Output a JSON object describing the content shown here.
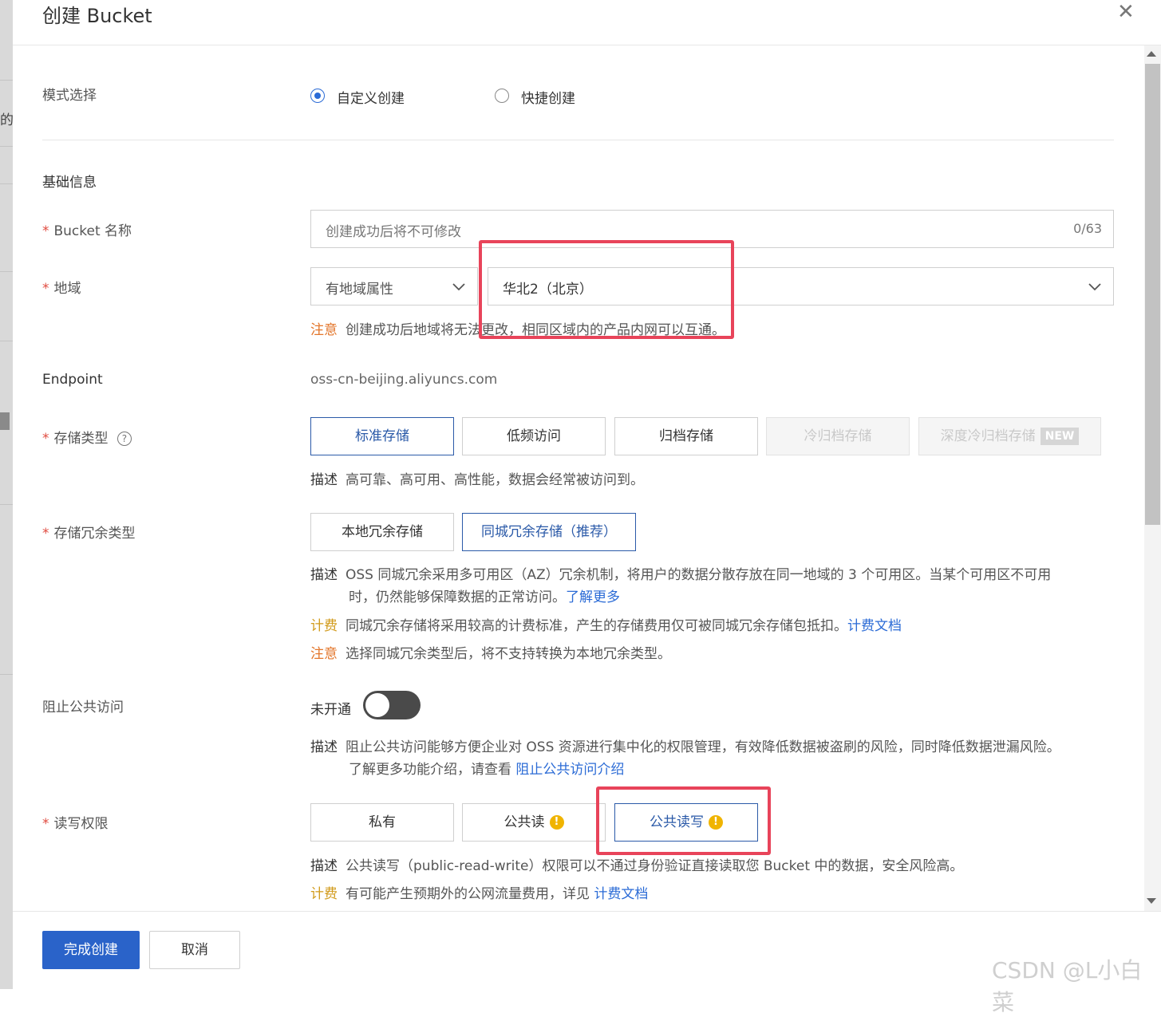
{
  "dialog": {
    "title": "创建 Bucket"
  },
  "mode": {
    "label": "模式选择",
    "options": [
      "自定义创建",
      "快捷创建"
    ],
    "selected": "自定义创建"
  },
  "basic": {
    "section_title": "基础信息"
  },
  "bucket_name": {
    "label": "Bucket 名称",
    "placeholder": "创建成功后将不可修改",
    "count": "0/63"
  },
  "region": {
    "label": "地域",
    "type_value": "有地域属性",
    "region_value": "华北2（北京）",
    "note_key": "注意",
    "note_text": "创建成功后地域将无法更改，相同区域内的产品内网可以互通。"
  },
  "endpoint": {
    "label": "Endpoint",
    "value": "oss-cn-beijing.aliyuncs.com"
  },
  "storage_class": {
    "label": "存储类型",
    "options": [
      "标准存储",
      "低频访问",
      "归档存储",
      "冷归档存储",
      "深度冷归档存储"
    ],
    "new_badge": "NEW",
    "selected": "标准存储",
    "desc_key": "描述",
    "desc_text": "高可靠、高可用、高性能，数据会经常被访问到。"
  },
  "redundancy": {
    "label": "存储冗余类型",
    "options": [
      "本地冗余存储",
      "同城冗余存储（推荐）"
    ],
    "selected": "同城冗余存储（推荐）",
    "desc_key": "描述",
    "desc_line1": "OSS 同城冗余采用多可用区（AZ）冗余机制，将用户的数据分散存放在同一地域的 3 个可用区。当某个可用区不可用",
    "desc_line2": "时，仍然能够保障数据的正常访问。",
    "desc_link": "了解更多",
    "fee_key": "计费",
    "fee_text": "同城冗余存储将采用较高的计费标准，产生的存储费用仅可被同城冗余存储包抵扣。",
    "fee_link": "计费文档",
    "note_key": "注意",
    "note_text": "选择同城冗余类型后，将不支持转换为本地冗余类型。"
  },
  "block_public": {
    "label": "阻止公共访问",
    "status": "未开通",
    "enabled": false,
    "desc_key": "描述",
    "desc_line1": "阻止公共访问能够方便企业对 OSS 资源进行集中化的权限管理，有效降低数据被盗刷的风险，同时降低数据泄漏风险。",
    "desc_line2": "了解更多功能介绍，请查看",
    "desc_link": "阻止公共访问介绍"
  },
  "acl": {
    "label": "读写权限",
    "options": [
      "私有",
      "公共读",
      "公共读写"
    ],
    "selected": "公共读写",
    "warn_symbol": "!",
    "desc_key": "描述",
    "desc_text": "公共读写（public-read-write）权限可以不通过身份验证直接读取您 Bucket 中的数据，安全风险高。",
    "fee_key": "计费",
    "fee_text": "有可能产生预期外的公网流量费用，详见",
    "fee_link": "计费文档"
  },
  "footer": {
    "confirm": "完成创建",
    "cancel": "取消"
  },
  "watermark": "CSDN @L小白菜",
  "colors": {
    "primary": "#2a63c9",
    "selected_border": "#2b5aa8",
    "warning": "#e3762b",
    "fee": "#d19a1a",
    "highlight_box": "#e8445a"
  }
}
